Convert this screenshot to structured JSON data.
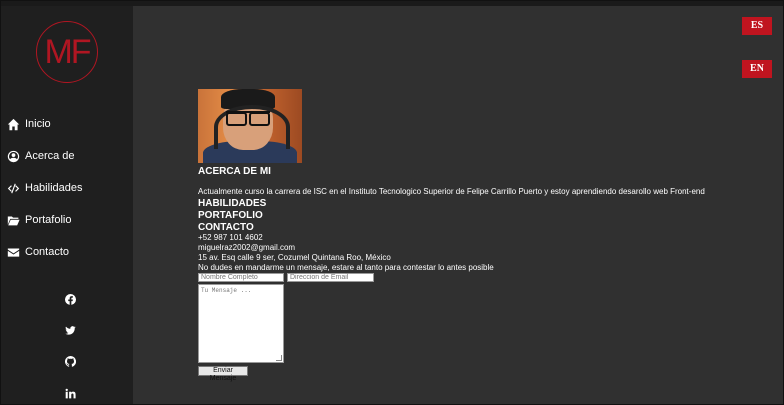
{
  "logo": {
    "text": "MF"
  },
  "nav": [
    {
      "label": "Inicio",
      "icon": "home-icon"
    },
    {
      "label": "Acerca de",
      "icon": "user-circle-icon"
    },
    {
      "label": "Habilidades",
      "icon": "code-icon"
    },
    {
      "label": "Portafolio",
      "icon": "folder-icon"
    },
    {
      "label": "Contacto",
      "icon": "envelope-icon"
    }
  ],
  "social": [
    "facebook-icon",
    "twitter-icon",
    "github-icon",
    "linkedin-icon"
  ],
  "language": {
    "es": "ES",
    "en": "EN"
  },
  "about": {
    "title": "ACERCA DE MI",
    "text": "Actualmente curso la carrera de ISC en el Instituto Tecnologico Superior de Felipe Carrillo Puerto y estoy aprendiendo desarollo web Front-end"
  },
  "sections": {
    "skills": "HABILIDADES",
    "portfolio": "PORTAFOLIO",
    "contact": "CONTACTO"
  },
  "contact": {
    "phone": "+52 987 101 4602",
    "email": "miguelraz2002@gmail.com",
    "address": "15 av. Esq calle 9 ser, Cozumel Quintana Roo, México",
    "note": "No dudes en mandarme un mensaje, estare al tanto para contestar lo antes posible"
  },
  "form": {
    "name_placeholder": "Nombre Completo",
    "email_placeholder": "Direccion de Email",
    "message_placeholder": "Tu Mensaje ...",
    "submit_label": "Enviar Mensaje"
  },
  "colors": {
    "accent": "#c0141f",
    "sidebar": "#1f1f1f",
    "background": "#303030"
  }
}
